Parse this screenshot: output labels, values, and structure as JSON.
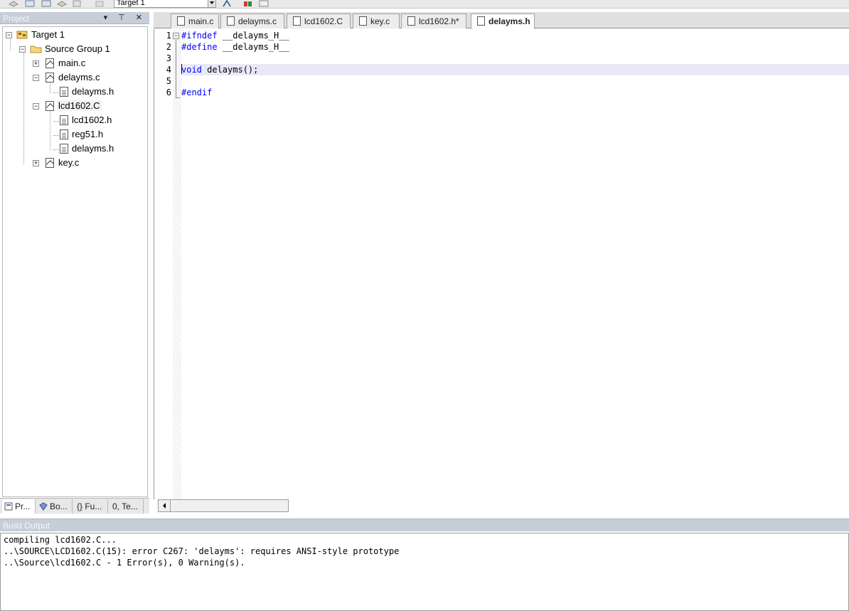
{
  "toolbar": {
    "target_value": "Target 1"
  },
  "project": {
    "title": "Project",
    "controls": "▾ ⊤ ✕",
    "tree": {
      "target": "Target 1",
      "group": "Source Group 1",
      "main_c": "main.c",
      "delayms_c": "delayms.c",
      "delayms_c_child": "delayms.h",
      "lcd1602_C": "lcd1602.C",
      "lcd1602_h": "lcd1602.h",
      "reg51_h": "reg51.h",
      "lcd_delayms_h": "delayms.h",
      "key_c": "key.c"
    },
    "tabs": [
      "Pr...",
      "Bo...",
      "{} Fu...",
      "0, Te..."
    ]
  },
  "editor": {
    "tabs": [
      "main.c",
      "delayms.c",
      "lcd1602.C",
      "key.c",
      "lcd1602.h*",
      "delayms.h"
    ],
    "active_tab": "delayms.h",
    "lines": [
      {
        "num": "1",
        "kw": "#ifndef",
        "rest": " __delayms_H__"
      },
      {
        "num": "2",
        "kw": "#define",
        "rest": " __delayms_H__"
      },
      {
        "num": "3",
        "kw": "",
        "rest": ""
      },
      {
        "num": "4",
        "kw": "void",
        "rest": " delayms();"
      },
      {
        "num": "5",
        "kw": "",
        "rest": ""
      },
      {
        "num": "6",
        "kw": "#endif",
        "rest": ""
      }
    ]
  },
  "build_output": {
    "title": "Build Output",
    "lines": [
      "compiling lcd1602.C...",
      "..\\SOURCE\\LCD1602.C(15): error C267: 'delayms': requires ANSI-style prototype",
      "..\\Source\\lcd1602.C - 1 Error(s), 0 Warning(s)."
    ]
  },
  "colors": {
    "panel_header": "#c6ced8",
    "keyword": "#0000ff",
    "current_line": "#e8e8f8"
  }
}
